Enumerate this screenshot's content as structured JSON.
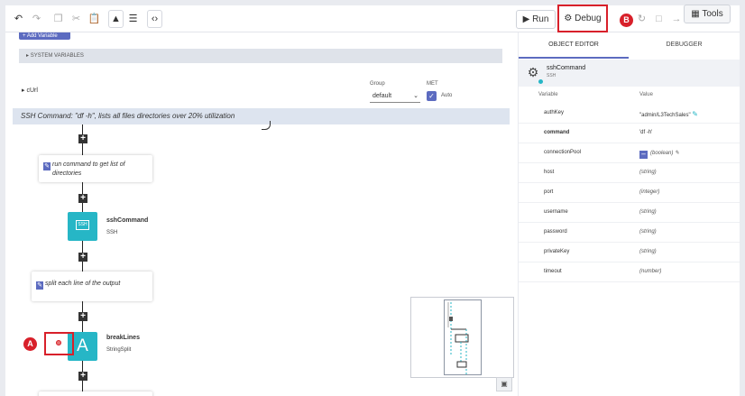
{
  "toolbar": {
    "run_label": "Run",
    "debug_label": "Debug",
    "tools_label": "Tools",
    "callout_b": "B"
  },
  "canvas": {
    "add_variable_label": "+ Add Variable",
    "system_variables_label": "SYSTEM VARIABLES",
    "curl_label": "cUrl",
    "group_label": "Group",
    "group_value": "default",
    "met_label": "MET",
    "auto_label": "Auto",
    "ssh_banner": "SSH Command: \"df -h\", lists all files directories over 20% utilization",
    "note1": "run command to get list of directories",
    "node_ssh": {
      "title": "sshCommand",
      "sub": "SSH",
      "icon_text": "SSH"
    },
    "note2": "split each line of the output",
    "node_break": {
      "title": "breakLines",
      "sub": "StringSplit",
      "icon_text": "A"
    },
    "callout_a": "A"
  },
  "panel": {
    "tab_object_editor": "OBJECT EDITOR",
    "tab_debugger": "DEBUGGER",
    "object_name": "sshCommand",
    "object_type": "SSH",
    "col_variable": "Variable",
    "col_value": "Value",
    "variables": [
      {
        "name": "authKey",
        "value": "\"admin/L3TechSales\""
      },
      {
        "name": "command",
        "value": "'df -h'"
      },
      {
        "name": "connectionPool",
        "value": "(boolean)"
      },
      {
        "name": "host",
        "value": "(string)"
      },
      {
        "name": "port",
        "value": "(integer)"
      },
      {
        "name": "username",
        "value": "(string)"
      },
      {
        "name": "password",
        "value": "(string)"
      },
      {
        "name": "privateKey",
        "value": "(string)"
      },
      {
        "name": "timeout",
        "value": "(number)"
      }
    ]
  },
  "colors": {
    "accent": "#5c6bc0",
    "teal": "#26b6c6",
    "highlight_red": "#d8202a"
  }
}
